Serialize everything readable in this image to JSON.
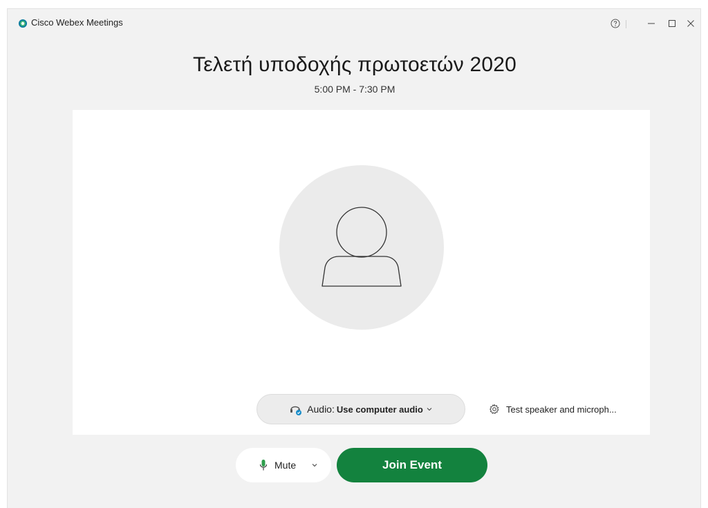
{
  "window": {
    "title": "Cisco Webex Meetings",
    "controls": [
      "help-icon",
      "minimize-icon",
      "maximize-icon",
      "close-icon"
    ]
  },
  "meeting": {
    "title": "Τελετή υποδοχής πρωτοετών 2020",
    "time": "5:00 PM - 7:30 PM"
  },
  "preview": {
    "avatar_icon": "person-icon"
  },
  "audio": {
    "label": "Audio:",
    "value": "Use computer audio",
    "icon": "headset-icon"
  },
  "test": {
    "label": "Test speaker and microph...",
    "icon": "gear-icon"
  },
  "actions": {
    "mute_label": "Mute",
    "join_label": "Join Event"
  },
  "colors": {
    "join_green": "#13823e",
    "mic_green": "#2e9d4c",
    "background": "#f2f2f2",
    "avatar_bg": "#ebebeb"
  }
}
